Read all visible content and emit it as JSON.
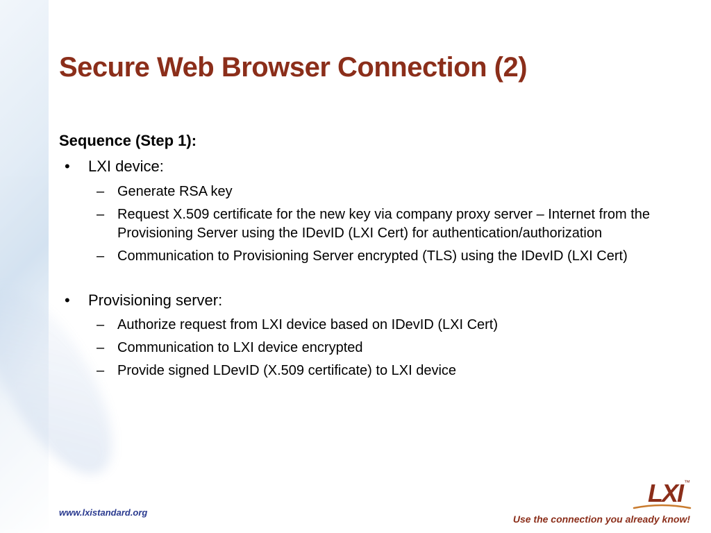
{
  "title": "Secure Web Browser Connection (2)",
  "sequence_heading": "Sequence (Step 1):",
  "bullets": [
    {
      "text": "LXI device:",
      "children": [
        "Generate RSA key",
        "Request X.509 certificate for the new key via company proxy server – Internet from the Provisioning Server using the IDevID (LXI Cert) for authentication/authorization",
        "Communication to Provisioning Server encrypted (TLS) using the IDevID (LXI Cert)"
      ]
    },
    {
      "text": "Provisioning server:",
      "children": [
        "Authorize request from LXI device based on IDevID (LXI Cert)",
        "Communication to LXI device encrypted",
        "Provide signed LDevID (X.509 certificate) to LXI device"
      ]
    }
  ],
  "footer_url": "www.lxistandard.org",
  "footer_tagline": "Use the connection you already know!",
  "logo_text": "LXI",
  "logo_tm": "™",
  "colors": {
    "title": "#8b2e1a",
    "footer_url": "#2a3a8f",
    "footer_tagline": "#8b2e1a"
  }
}
